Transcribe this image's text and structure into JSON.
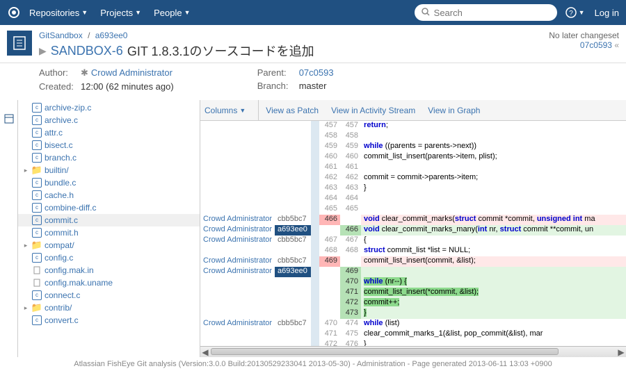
{
  "nav": {
    "items": [
      "Repositories",
      "Projects",
      "People"
    ],
    "search_placeholder": "Search",
    "login": "Log in"
  },
  "breadcrumb": {
    "repo": "GitSandbox",
    "rev": "a693ee0"
  },
  "issue": {
    "key": "SANDBOX-6",
    "summary": "GIT 1.8.3.1のソースコードを追加"
  },
  "changeset": {
    "no_later": "No later changeset",
    "rev": "07c0593"
  },
  "meta": {
    "author_label": "Author:",
    "author": "Crowd Administrator",
    "created_label": "Created:",
    "created": "12:00 (62 minutes ago)",
    "parent_label": "Parent:",
    "parent": "07c0593",
    "branch_label": "Branch:",
    "branch": "master"
  },
  "tree": [
    {
      "name": "archive-zip.c",
      "type": "c"
    },
    {
      "name": "archive.c",
      "type": "c"
    },
    {
      "name": "attr.c",
      "type": "c"
    },
    {
      "name": "bisect.c",
      "type": "c"
    },
    {
      "name": "branch.c",
      "type": "c"
    },
    {
      "name": "builtin/",
      "type": "folder",
      "expandable": true
    },
    {
      "name": "bundle.c",
      "type": "c"
    },
    {
      "name": "cache.h",
      "type": "c"
    },
    {
      "name": "combine-diff.c",
      "type": "c"
    },
    {
      "name": "commit.c",
      "type": "c",
      "selected": true
    },
    {
      "name": "commit.h",
      "type": "c"
    },
    {
      "name": "compat/",
      "type": "folder",
      "expandable": true
    },
    {
      "name": "config.c",
      "type": "c"
    },
    {
      "name": "config.mak.in",
      "type": "file"
    },
    {
      "name": "config.mak.uname",
      "type": "file"
    },
    {
      "name": "connect.c",
      "type": "c"
    },
    {
      "name": "contrib/",
      "type": "folder",
      "expandable": true
    },
    {
      "name": "convert.c",
      "type": "c"
    }
  ],
  "toolbar": {
    "columns": "Columns",
    "patch": "View as Patch",
    "activity": "View in Activity Stream",
    "graph": "View in Graph"
  },
  "diff": {
    "author": "Crowd Administrator",
    "rows": [
      {
        "a": "",
        "r": "",
        "lo": "457",
        "ln": "457",
        "code": "                return;"
      },
      {
        "a": "",
        "r": "",
        "lo": "458",
        "ln": "458",
        "code": ""
      },
      {
        "a": "",
        "r": "",
        "lo": "459",
        "ln": "459",
        "code": "        while ((parents = parents->next))"
      },
      {
        "a": "",
        "r": "",
        "lo": "460",
        "ln": "460",
        "code": "                commit_list_insert(parents->item, plist);"
      },
      {
        "a": "",
        "r": "",
        "lo": "461",
        "ln": "461",
        "code": ""
      },
      {
        "a": "",
        "r": "",
        "lo": "462",
        "ln": "462",
        "code": "        commit = commit->parents->item;"
      },
      {
        "a": "",
        "r": "",
        "lo": "463",
        "ln": "463",
        "code": "    }"
      },
      {
        "a": "",
        "r": "",
        "lo": "464",
        "ln": "464",
        "code": ""
      },
      {
        "a": "",
        "r": "",
        "lo": "465",
        "ln": "465",
        "code": ""
      },
      {
        "a": "Crowd Administrator",
        "r": "cbb5bc7",
        "lo": "466",
        "ln": "",
        "kind": "removed",
        "code": "void clear_commit_marks(struct commit *commit, unsigned int ma"
      },
      {
        "a": "Crowd Administrator",
        "r": "a693ee0",
        "rcur": true,
        "lo": "",
        "ln": "466",
        "kind": "added",
        "code": "void clear_commit_marks_many(int nr, struct commit **commit, un"
      },
      {
        "a": "Crowd Administrator",
        "r": "cbb5bc7",
        "lo": "467",
        "ln": "467",
        "code": "{"
      },
      {
        "a": "",
        "r": "",
        "lo": "468",
        "ln": "468",
        "code": "        struct commit_list *list = NULL;"
      },
      {
        "a": "Crowd Administrator",
        "r": "cbb5bc7",
        "lo": "469",
        "ln": "",
        "kind": "removed",
        "code": "        commit_list_insert(commit, &list);"
      },
      {
        "a": "Crowd Administrator",
        "r": "a693ee0",
        "rcur": true,
        "lo": "",
        "ln": "469",
        "kind": "added",
        "hl": true,
        "code": ""
      },
      {
        "a": "",
        "r": "",
        "lo": "",
        "ln": "470",
        "kind": "added",
        "hl": true,
        "code": "        while (nr--) {"
      },
      {
        "a": "",
        "r": "",
        "lo": "",
        "ln": "471",
        "kind": "added",
        "hl": true,
        "code": "                commit_list_insert(*commit, &list);"
      },
      {
        "a": "",
        "r": "",
        "lo": "",
        "ln": "472",
        "kind": "added",
        "hl": true,
        "code": "                commit++;"
      },
      {
        "a": "",
        "r": "",
        "lo": "",
        "ln": "473",
        "kind": "added",
        "hl": true,
        "code": "        }"
      },
      {
        "a": "Crowd Administrator",
        "r": "cbb5bc7",
        "lo": "470",
        "ln": "474",
        "code": "        while (list)"
      },
      {
        "a": "",
        "r": "",
        "lo": "471",
        "ln": "475",
        "code": "                clear_commit_marks_1(&list, pop_commit(&list), mar"
      },
      {
        "a": "",
        "r": "",
        "lo": "472",
        "ln": "476",
        "code": "}"
      }
    ]
  },
  "footer": "Atlassian FishEye Git analysis (Version:3.0.0 Build:20130529233041 2013-05-30) - Administration - Page generated 2013-06-11 13:03 +0900"
}
